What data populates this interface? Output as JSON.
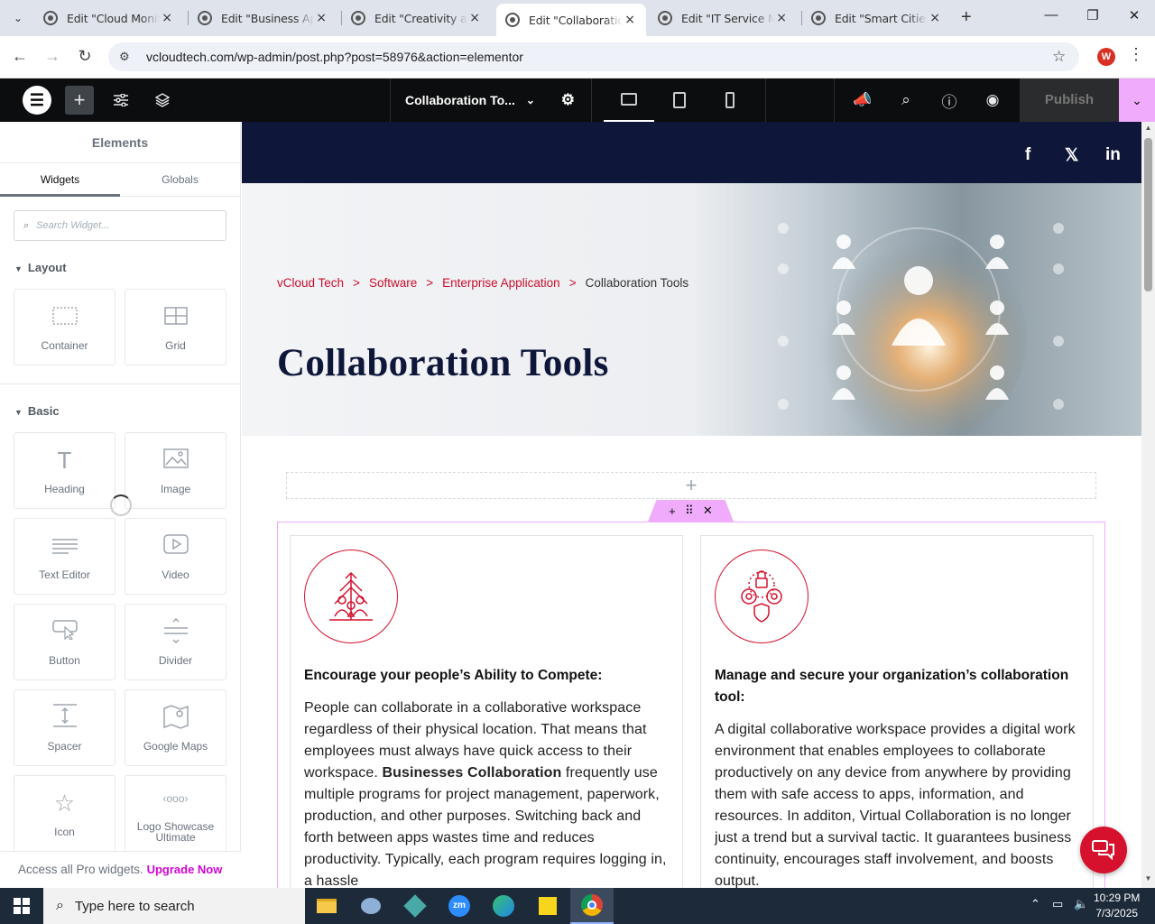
{
  "browser": {
    "tabs": [
      {
        "title": "Edit \"Cloud Monitoring",
        "close": "×"
      },
      {
        "title": "Edit \"Business Applications",
        "close": "×"
      },
      {
        "title": "Edit \"Creativity and",
        "close": "×"
      },
      {
        "title": "Edit \"Collaboration Tools",
        "close": "×",
        "active": true
      },
      {
        "title": "Edit \"IT Service Management",
        "close": "×"
      },
      {
        "title": "Edit \"Smart Cities\"",
        "close": "×"
      }
    ],
    "url": "vcloudtech.com/wp-admin/post.php?post=58976&action=elementor",
    "profile_initial": "W"
  },
  "editor": {
    "document_title": "Collaboration To...",
    "publish_label": "Publish"
  },
  "panel": {
    "title": "Elements",
    "tabs": [
      "Widgets",
      "Globals"
    ],
    "search_placeholder": "Search Widget...",
    "sections": [
      {
        "label": "Layout",
        "widgets": [
          "Container",
          "Grid"
        ]
      },
      {
        "label": "Basic",
        "widgets": [
          "Heading",
          "Image",
          "Text Editor",
          "Video",
          "Button",
          "Divider",
          "Spacer",
          "Google Maps",
          "Icon",
          "Logo Showcase Ultimate"
        ]
      }
    ],
    "pro_text": "Access all Pro widgets.",
    "pro_link": "Upgrade Now"
  },
  "page": {
    "social": [
      "f",
      "𝕏",
      "in"
    ],
    "breadcrumb": [
      "vCloud Tech",
      "Software",
      "Enterprise Application",
      "Collaboration Tools"
    ],
    "breadcrumb_sep": ">",
    "title": "Collaboration Tools",
    "cards": [
      {
        "heading": "Encourage your people’s Ability to Compete:",
        "text_1": "People can collaborate in a collaborative workspace regardless of their physical location. That means that employees must always have quick access to their workspace. ",
        "bold": "Businesses Collaboration",
        "text_2": " frequently use multiple programs for project management, paperwork, production, and other purposes. Switching back and forth between apps wastes time and reduces productivity. Typically, each program requires logging in, a hassle"
      },
      {
        "heading": "Manage and secure your organization’s collaboration tool:",
        "text_1": "A digital collaborative workspace provides a digital work environment that enables employees to collaborate productively on any device from anywhere by providing them with safe access to apps, information, and resources. In additon, Virtual Collaboration is no longer just a trend but a survival tactic. It guarantees business continuity, encourages staff involvement, and boosts output.",
        "bold": "",
        "text_2": ""
      }
    ]
  },
  "taskbar": {
    "search_placeholder": "Type here to search",
    "time": "10:29 PM",
    "date": "7/3/2025"
  },
  "colors": {
    "accent": "#d6112d",
    "navy": "#0e1739",
    "elementor_pink": "#f0abfc"
  }
}
